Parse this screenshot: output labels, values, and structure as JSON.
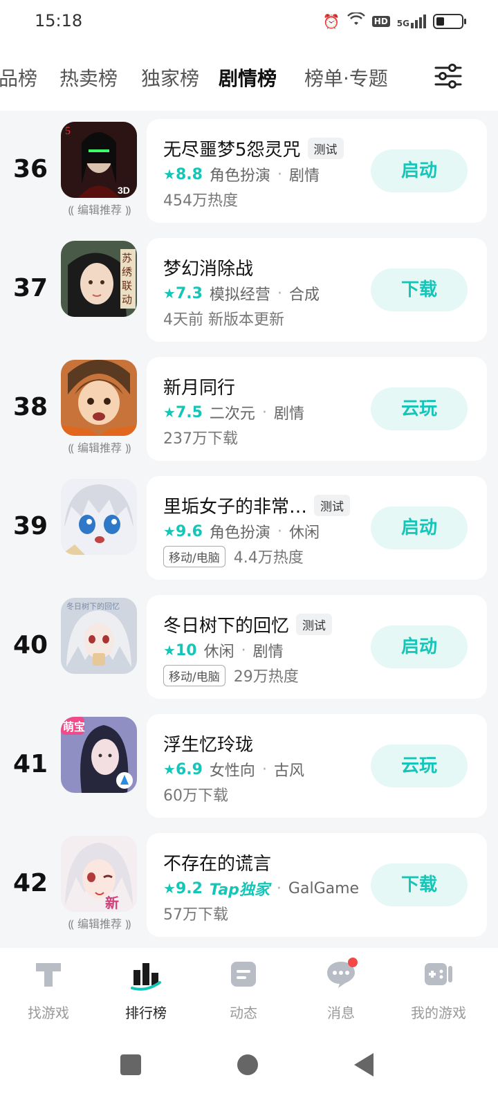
{
  "status_bar": {
    "time": "15:18",
    "icons": [
      "alarm-icon",
      "wifi-icon",
      "hd-icon",
      "signal-5g-icon",
      "battery-icon"
    ],
    "hd_label": "HD",
    "network_label": "5G",
    "battery_level": 0.3
  },
  "tabs": [
    {
      "label": "品榜",
      "active": false
    },
    {
      "label": "热卖榜",
      "active": false
    },
    {
      "label": "独家榜",
      "active": false
    },
    {
      "label": "剧情榜",
      "active": true
    },
    {
      "label": "榜单·专题",
      "active": false
    }
  ],
  "filter_icon": "filter-sliders-icon",
  "games": [
    {
      "rank": "36",
      "name": "无尽噩梦5怨灵咒",
      "badge": "测试",
      "rating": "8.8",
      "tags": [
        "角色扮演",
        "剧情"
      ],
      "platform": "",
      "stat": "454万热度",
      "action": "启动",
      "editor_pick": "编辑推荐"
    },
    {
      "rank": "37",
      "name": "梦幻消除战",
      "badge": "",
      "rating": "7.3",
      "tags": [
        "模拟经营",
        "合成"
      ],
      "platform": "",
      "stat": "4天前 新版本更新",
      "action": "下载",
      "editor_pick": ""
    },
    {
      "rank": "38",
      "name": "新月同行",
      "badge": "",
      "rating": "7.5",
      "tags": [
        "二次元",
        "剧情"
      ],
      "platform": "",
      "stat": "237万下载",
      "action": "云玩",
      "editor_pick": "编辑推荐"
    },
    {
      "rank": "39",
      "name": "里垢女子的非常…",
      "badge": "测试",
      "rating": "9.6",
      "tags": [
        "角色扮演",
        "休闲"
      ],
      "platform": "移动/电脑",
      "stat": "4.4万热度",
      "action": "启动",
      "editor_pick": ""
    },
    {
      "rank": "40",
      "name": "冬日树下的回忆",
      "badge": "测试",
      "rating": "10",
      "tags": [
        "休闲",
        "剧情"
      ],
      "platform": "移动/电脑",
      "stat": "29万热度",
      "action": "启动",
      "editor_pick": ""
    },
    {
      "rank": "41",
      "name": "浮生忆玲珑",
      "badge": "",
      "rating": "6.9",
      "tags": [
        "女性向",
        "古风"
      ],
      "platform": "",
      "stat": "60万下载",
      "action": "云玩",
      "editor_pick": ""
    },
    {
      "rank": "42",
      "name": "不存在的谎言",
      "badge": "",
      "rating": "9.2",
      "exclusive": "Tap独家",
      "tags": [
        "GalGame"
      ],
      "platform": "",
      "stat": "57万下载",
      "action": "下载",
      "editor_pick": "编辑推荐"
    }
  ],
  "bottom_nav": [
    {
      "label": "找游戏",
      "icon": "find-games-icon",
      "active": false
    },
    {
      "label": "排行榜",
      "icon": "ranking-icon",
      "active": true
    },
    {
      "label": "动态",
      "icon": "feed-icon",
      "active": false
    },
    {
      "label": "消息",
      "icon": "message-icon",
      "active": false,
      "has_badge": true
    },
    {
      "label": "我的游戏",
      "icon": "my-games-icon",
      "active": false
    }
  ],
  "colors": {
    "accent": "#15c5b7",
    "action_bg": "#e6f8f6",
    "badge_red": "#f24848"
  }
}
